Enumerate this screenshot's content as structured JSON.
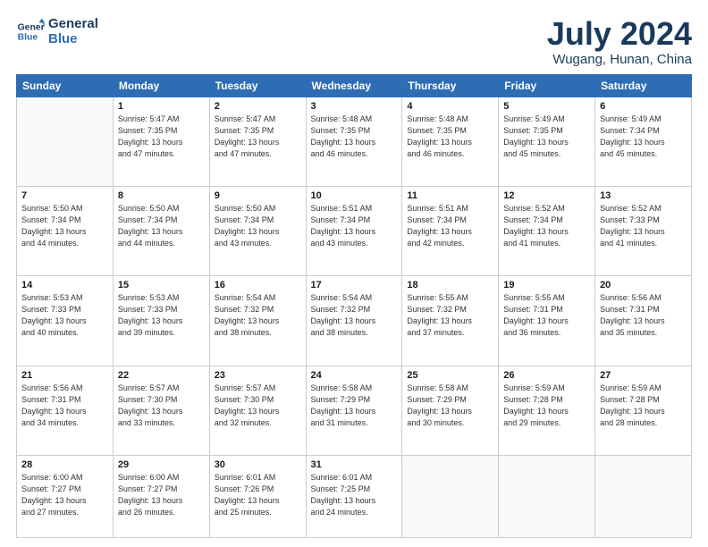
{
  "logo": {
    "line1": "General",
    "line2": "Blue"
  },
  "title": "July 2024",
  "location": "Wugang, Hunan, China",
  "days_of_week": [
    "Sunday",
    "Monday",
    "Tuesday",
    "Wednesday",
    "Thursday",
    "Friday",
    "Saturday"
  ],
  "weeks": [
    [
      {
        "day": "",
        "info": ""
      },
      {
        "day": "1",
        "info": "Sunrise: 5:47 AM\nSunset: 7:35 PM\nDaylight: 13 hours\nand 47 minutes."
      },
      {
        "day": "2",
        "info": "Sunrise: 5:47 AM\nSunset: 7:35 PM\nDaylight: 13 hours\nand 47 minutes."
      },
      {
        "day": "3",
        "info": "Sunrise: 5:48 AM\nSunset: 7:35 PM\nDaylight: 13 hours\nand 46 minutes."
      },
      {
        "day": "4",
        "info": "Sunrise: 5:48 AM\nSunset: 7:35 PM\nDaylight: 13 hours\nand 46 minutes."
      },
      {
        "day": "5",
        "info": "Sunrise: 5:49 AM\nSunset: 7:35 PM\nDaylight: 13 hours\nand 45 minutes."
      },
      {
        "day": "6",
        "info": "Sunrise: 5:49 AM\nSunset: 7:34 PM\nDaylight: 13 hours\nand 45 minutes."
      }
    ],
    [
      {
        "day": "7",
        "info": "Sunrise: 5:50 AM\nSunset: 7:34 PM\nDaylight: 13 hours\nand 44 minutes."
      },
      {
        "day": "8",
        "info": "Sunrise: 5:50 AM\nSunset: 7:34 PM\nDaylight: 13 hours\nand 44 minutes."
      },
      {
        "day": "9",
        "info": "Sunrise: 5:50 AM\nSunset: 7:34 PM\nDaylight: 13 hours\nand 43 minutes."
      },
      {
        "day": "10",
        "info": "Sunrise: 5:51 AM\nSunset: 7:34 PM\nDaylight: 13 hours\nand 43 minutes."
      },
      {
        "day": "11",
        "info": "Sunrise: 5:51 AM\nSunset: 7:34 PM\nDaylight: 13 hours\nand 42 minutes."
      },
      {
        "day": "12",
        "info": "Sunrise: 5:52 AM\nSunset: 7:34 PM\nDaylight: 13 hours\nand 41 minutes."
      },
      {
        "day": "13",
        "info": "Sunrise: 5:52 AM\nSunset: 7:33 PM\nDaylight: 13 hours\nand 41 minutes."
      }
    ],
    [
      {
        "day": "14",
        "info": "Sunrise: 5:53 AM\nSunset: 7:33 PM\nDaylight: 13 hours\nand 40 minutes."
      },
      {
        "day": "15",
        "info": "Sunrise: 5:53 AM\nSunset: 7:33 PM\nDaylight: 13 hours\nand 39 minutes."
      },
      {
        "day": "16",
        "info": "Sunrise: 5:54 AM\nSunset: 7:32 PM\nDaylight: 13 hours\nand 38 minutes."
      },
      {
        "day": "17",
        "info": "Sunrise: 5:54 AM\nSunset: 7:32 PM\nDaylight: 13 hours\nand 38 minutes."
      },
      {
        "day": "18",
        "info": "Sunrise: 5:55 AM\nSunset: 7:32 PM\nDaylight: 13 hours\nand 37 minutes."
      },
      {
        "day": "19",
        "info": "Sunrise: 5:55 AM\nSunset: 7:31 PM\nDaylight: 13 hours\nand 36 minutes."
      },
      {
        "day": "20",
        "info": "Sunrise: 5:56 AM\nSunset: 7:31 PM\nDaylight: 13 hours\nand 35 minutes."
      }
    ],
    [
      {
        "day": "21",
        "info": "Sunrise: 5:56 AM\nSunset: 7:31 PM\nDaylight: 13 hours\nand 34 minutes."
      },
      {
        "day": "22",
        "info": "Sunrise: 5:57 AM\nSunset: 7:30 PM\nDaylight: 13 hours\nand 33 minutes."
      },
      {
        "day": "23",
        "info": "Sunrise: 5:57 AM\nSunset: 7:30 PM\nDaylight: 13 hours\nand 32 minutes."
      },
      {
        "day": "24",
        "info": "Sunrise: 5:58 AM\nSunset: 7:29 PM\nDaylight: 13 hours\nand 31 minutes."
      },
      {
        "day": "25",
        "info": "Sunrise: 5:58 AM\nSunset: 7:29 PM\nDaylight: 13 hours\nand 30 minutes."
      },
      {
        "day": "26",
        "info": "Sunrise: 5:59 AM\nSunset: 7:28 PM\nDaylight: 13 hours\nand 29 minutes."
      },
      {
        "day": "27",
        "info": "Sunrise: 5:59 AM\nSunset: 7:28 PM\nDaylight: 13 hours\nand 28 minutes."
      }
    ],
    [
      {
        "day": "28",
        "info": "Sunrise: 6:00 AM\nSunset: 7:27 PM\nDaylight: 13 hours\nand 27 minutes."
      },
      {
        "day": "29",
        "info": "Sunrise: 6:00 AM\nSunset: 7:27 PM\nDaylight: 13 hours\nand 26 minutes."
      },
      {
        "day": "30",
        "info": "Sunrise: 6:01 AM\nSunset: 7:26 PM\nDaylight: 13 hours\nand 25 minutes."
      },
      {
        "day": "31",
        "info": "Sunrise: 6:01 AM\nSunset: 7:25 PM\nDaylight: 13 hours\nand 24 minutes."
      },
      {
        "day": "",
        "info": ""
      },
      {
        "day": "",
        "info": ""
      },
      {
        "day": "",
        "info": ""
      }
    ]
  ]
}
